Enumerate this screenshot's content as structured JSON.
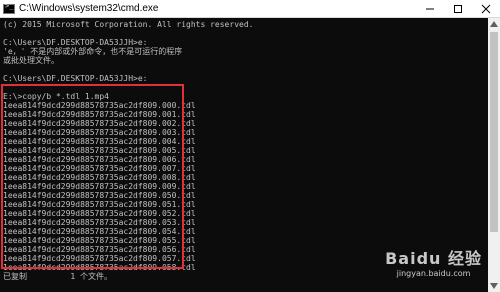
{
  "window": {
    "title": "C:\\Windows\\system32\\cmd.exe",
    "controls": [
      "minimize-icon",
      "maximize-icon",
      "close-icon"
    ]
  },
  "console": {
    "header_lines": [
      "(c) 2015 Microsoft Corporation. All rights reserved.",
      "",
      "C:\\Users\\DF.DESKTOP-DA53JJH>e:",
      "'e，' 不是内部或外部命令，也不是可运行的程序",
      "或批处理文件。",
      "",
      "C:\\Users\\DF.DESKTOP-DA53JJH>e:",
      ""
    ],
    "command": "E:\\>copy/b *.tdl 1.mp4",
    "files": [
      "1eea814f9dcd299d88578735ac2df809.000.tdl",
      "1eea814f9dcd299d88578735ac2df809.001.tdl",
      "1eea814f9dcd299d88578735ac2df809.002.tdl",
      "1eea814f9dcd299d88578735ac2df809.003.tdl",
      "1eea814f9dcd299d88578735ac2df809.004.tdl",
      "1eea814f9dcd299d88578735ac2df809.005.tdl",
      "1eea814f9dcd299d88578735ac2df809.006.tdl",
      "1eea814f9dcd299d88578735ac2df809.007.tdl",
      "1eea814f9dcd299d88578735ac2df809.008.tdl",
      "1eea814f9dcd299d88578735ac2df809.009.tdl",
      "1eea814f9dcd299d88578735ac2df809.050.tdl",
      "1eea814f9dcd299d88578735ac2df809.051.tdl",
      "1eea814f9dcd299d88578735ac2df809.052.tdl",
      "1eea814f9dcd299d88578735ac2df809.053.tdl",
      "1eea814f9dcd299d88578735ac2df809.054.tdl",
      "1eea814f9dcd299d88578735ac2df809.055.tdl",
      "1eea814f9dcd299d88578735ac2df809.056.tdl",
      "1eea814f9dcd299d88578735ac2df809.057.tdl",
      "1eea814f9dcd299d88578735ac2df809.058.tdl"
    ],
    "summary": "已复制         1 个文件。",
    "text_color": "#c0c0c0",
    "background_color": "#0c0c0c"
  },
  "highlight": {
    "color": "#e0303a"
  },
  "watermark": {
    "logo": "Baidu 经验",
    "url": "jingyan.baidu.com"
  }
}
